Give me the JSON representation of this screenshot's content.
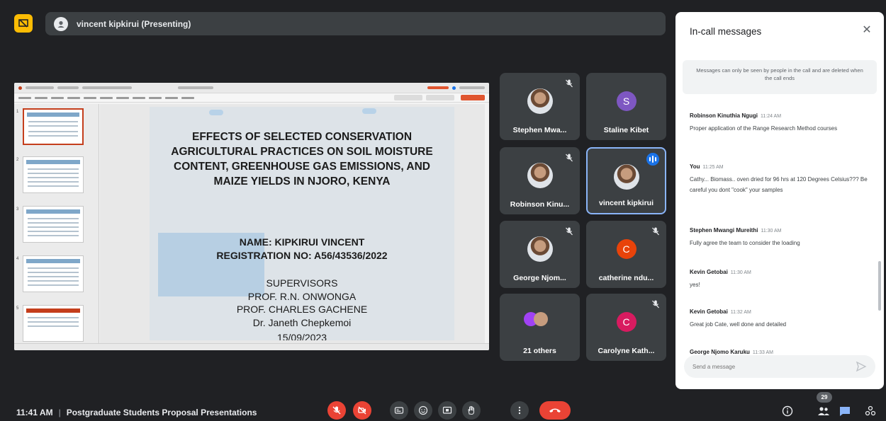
{
  "presenter": {
    "label": "vincent kipkirui (Presenting)"
  },
  "slide": {
    "title": "EFFECTS OF SELECTED CONSERVATION AGRICULTURAL PRACTICES ON SOIL MOISTURE CONTENT, GREENHOUSE GAS EMISSIONS, AND MAIZE YIELDS IN NJORO, KENYA",
    "name": "NAME: KIPKIRUI VINCENT",
    "registration": "REGISTRATION NO: A56/43536/2022",
    "supervisors_heading": "SUPERVISORS",
    "supervisor_1": "PROF. R.N. ONWONGA",
    "supervisor_2": "PROF. CHARLES GACHENE",
    "supervisor_3": "Dr. Janeth Chepkemoi",
    "date": "15/09/2023"
  },
  "tiles": [
    {
      "name": "Stephen Mwa...",
      "type": "photo",
      "muted": true
    },
    {
      "name": "Staline Kibet",
      "type": "letter",
      "letter": "S",
      "color": "#7e57c2",
      "muted": false
    },
    {
      "name": "Robinson Kinu...",
      "type": "photo",
      "muted": true
    },
    {
      "name": "vincent kipkirui",
      "type": "photo",
      "muted": false,
      "speaking": true
    },
    {
      "name": "George Njom...",
      "type": "photo",
      "muted": true
    },
    {
      "name": "catherine ndu...",
      "type": "letter",
      "letter": "C",
      "color": "#e8430a",
      "muted": true
    },
    {
      "name": "21 others",
      "type": "group",
      "muted": false
    },
    {
      "name": "Carolyne Kath...",
      "type": "letter",
      "letter": "C",
      "color": "#d81b60",
      "muted": true
    }
  ],
  "chat": {
    "title": "In-call messages",
    "notice": "Messages can only be seen by people in the call and are deleted when the call ends",
    "messages": [
      {
        "sender": "Robinson Kinuthia Ngugi",
        "time": "11:24 AM",
        "text": "Proper application of the Range Research Method courses"
      },
      {
        "sender": "You",
        "time": "11:25 AM",
        "text": "Cathy... Biomass.. oven dried for 96 hrs at 120 Degrees Celsius??? Be careful you dont \"cook\" your samples"
      },
      {
        "sender": "Stephen Mwangi Mureithi",
        "time": "11:30 AM",
        "text": "Fully agree the team to consider the loading"
      },
      {
        "sender": "Kevin Getobai",
        "time": "11:30 AM",
        "text": "yes!"
      },
      {
        "sender": "Kevin Getobai",
        "time": "11:32 AM",
        "text": "Great job Cate, well done and detailed"
      },
      {
        "sender": "George Njomo Karuku",
        "time": "11:33 AM",
        "text": ""
      }
    ],
    "input_placeholder": "Send a message"
  },
  "bottom": {
    "time": "11:41 AM",
    "meeting_title": "Postgraduate Students Proposal Presentations",
    "participant_count": "29"
  },
  "colors": {
    "end_call": "#ea4335",
    "accent": "#8ab4f8",
    "present_badge": "#fbbc04"
  }
}
